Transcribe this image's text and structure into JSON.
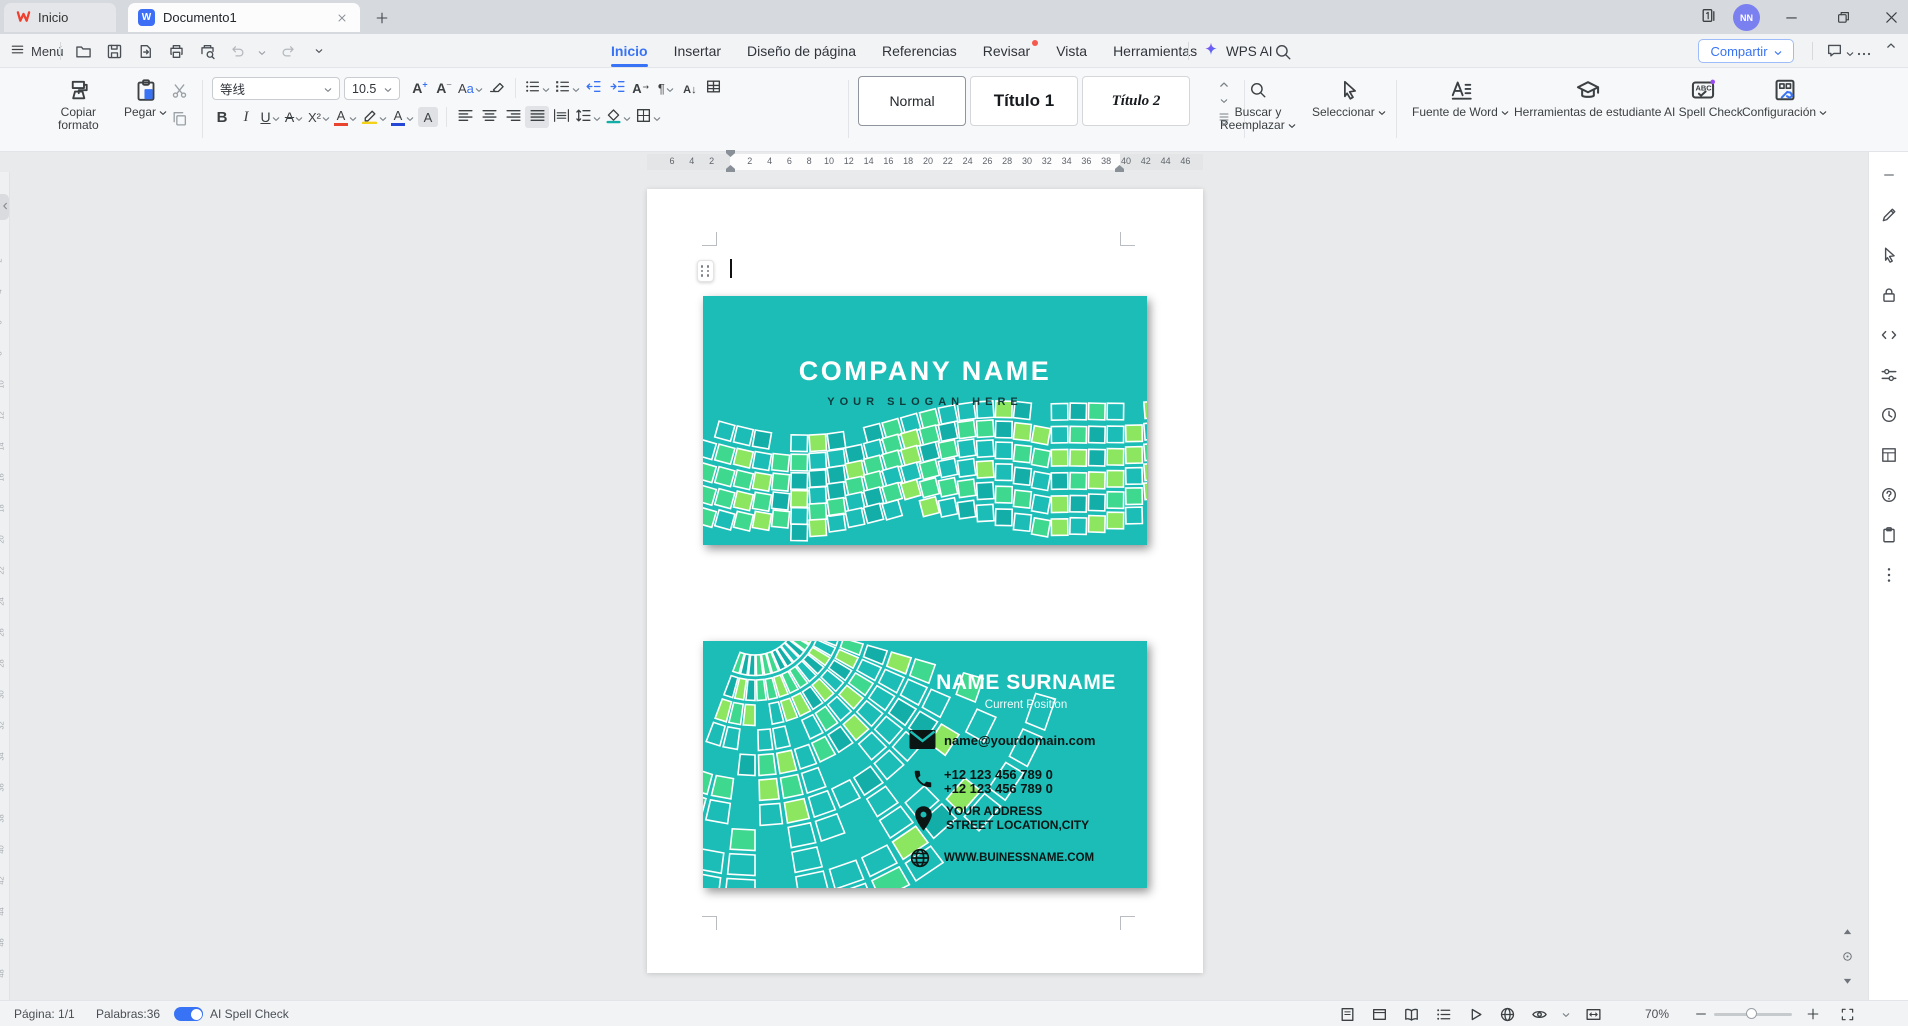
{
  "window": {
    "home_tab": "Inicio",
    "doc_tab": "Documento1",
    "avatar_initials": "NN",
    "share_label": "Compartir"
  },
  "menu_row": {
    "menu_label": "Menú",
    "items": [
      {
        "label": "Inicio",
        "active": true,
        "badge": false
      },
      {
        "label": "Insertar",
        "active": false,
        "badge": false
      },
      {
        "label": "Diseño de página",
        "active": false,
        "badge": false
      },
      {
        "label": "Referencias",
        "active": false,
        "badge": false
      },
      {
        "label": "Revisar",
        "active": false,
        "badge": true
      },
      {
        "label": "Vista",
        "active": false,
        "badge": false
      },
      {
        "label": "Herramientas",
        "active": false,
        "badge": false
      }
    ],
    "wps_ai_label": "WPS AI",
    "quick_icons": [
      "folder-open",
      "save",
      "export",
      "printer",
      "print-preview"
    ]
  },
  "ribbon": {
    "copy_format_line1": "Copiar",
    "copy_format_line2": "formato",
    "paste_label": "Pegar",
    "font_name": "等线",
    "font_size": "10.5",
    "row1_icons": [
      {
        "icon": "font-increase"
      },
      {
        "icon": "font-decrease"
      },
      {
        "icon": "change-case",
        "chev": true
      },
      {
        "icon": "eraser"
      },
      {
        "sep": true
      },
      {
        "icon": "bullet-list",
        "chev": true
      },
      {
        "icon": "numbered-list",
        "chev": true
      },
      {
        "icon": "decrease-indent"
      },
      {
        "icon": "increase-indent"
      },
      {
        "icon": "text-layout"
      },
      {
        "icon": "paragraph-mark",
        "chev": true
      },
      {
        "icon": "sort-az"
      },
      {
        "icon": "table-grid"
      }
    ],
    "row2_icons": [
      {
        "icon": "bold"
      },
      {
        "icon": "italic"
      },
      {
        "icon": "underline",
        "chev": true
      },
      {
        "icon": "strikethrough",
        "chev": true
      },
      {
        "icon": "superscript",
        "chev": true
      },
      {
        "icon": "char-effect",
        "chev": true
      },
      {
        "icon": "highlighter",
        "chev": true
      },
      {
        "icon": "font-color",
        "chev": true
      },
      {
        "icon": "char-shading-box"
      },
      {
        "sep": true
      },
      {
        "icon": "align-left"
      },
      {
        "icon": "align-center"
      },
      {
        "icon": "align-right"
      },
      {
        "icon": "align-justify",
        "active": true
      },
      {
        "icon": "distribute"
      },
      {
        "icon": "line-spacing",
        "chev": true
      },
      {
        "icon": "shading",
        "chev": true
      },
      {
        "icon": "borders",
        "chev": true
      }
    ],
    "styles": [
      {
        "label": "Normal",
        "selected": true,
        "kind": "normal"
      },
      {
        "label": "Título 1",
        "selected": false,
        "kind": "t1"
      },
      {
        "label": "Título 2",
        "selected": false,
        "kind": "t2"
      }
    ],
    "find_line1": "Buscar y",
    "find_line2": "Reemplazar",
    "select_label": "Seleccionar",
    "word_font_label": "Fuente de Word",
    "student_label": "Herramientas de estudiante",
    "ai_spell_label": "AI Spell Check",
    "config_label": "Configuración"
  },
  "ruler": {
    "left_numbers": [
      "6",
      "4",
      "2"
    ],
    "right_numbers": [
      "2",
      "4",
      "6",
      "8",
      "10",
      "12",
      "14",
      "16",
      "18",
      "20",
      "22",
      "24",
      "26",
      "28",
      "30",
      "32",
      "34",
      "36",
      "38",
      "40",
      "42",
      "44",
      "46"
    ],
    "vertical_numbers": [
      "2",
      "4",
      "6",
      "8",
      "10",
      "12",
      "14",
      "16",
      "18",
      "20",
      "22",
      "24",
      "26",
      "28",
      "30",
      "32",
      "34",
      "36",
      "38",
      "40",
      "42",
      "44",
      "46",
      "48"
    ]
  },
  "document": {
    "card_front": {
      "company_name": "COMPANY NAME",
      "slogan": "YOUR SLOGAN HERE"
    },
    "card_back": {
      "name": "NAME SURNAME",
      "position": "Current Position",
      "email": "name@yourdomain.com",
      "phone_line1": "+12 123 456 789 0",
      "phone_line2": "+12 123 456 789 0",
      "address_line1": "YOUR ADDRESS",
      "address_line2": "STREET LOCATION,CITY",
      "website": "WWW.BUINESSNAME.COM"
    }
  },
  "right_sidebar_icons": [
    "minus",
    "pen",
    "select-arrow",
    "lock",
    "code",
    "sliders",
    "history",
    "page-layout",
    "help",
    "clipboard-small",
    "more-dots"
  ],
  "status_bar": {
    "page": "Página: 1/1",
    "words": "Palabras:36",
    "spell_label": "AI Spell Check",
    "zoom_value": "70%",
    "right_icons": [
      "page-select",
      "page-layout2",
      "read-book",
      "outline-list",
      "autoplay",
      "web-globe",
      "eye-protect",
      "fit-width"
    ]
  },
  "colors": {
    "teal": "#1BBDB6",
    "tile_teal": "#14AEA9",
    "tile_green": "#3ED98F",
    "tile_light": "#8CE65F",
    "accent": "#3873F5"
  }
}
